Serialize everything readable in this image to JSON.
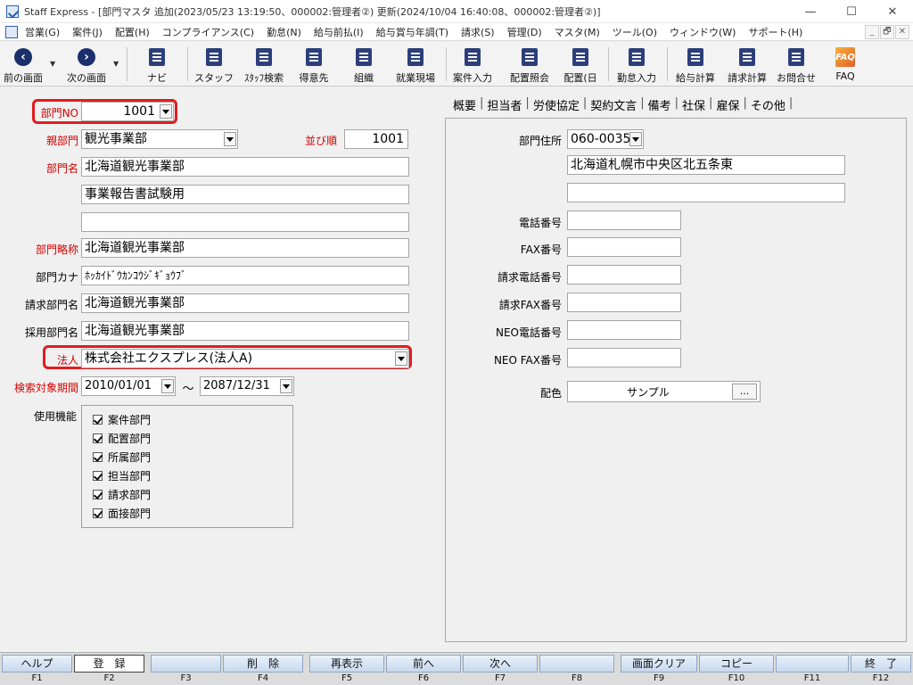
{
  "window": {
    "title": "Staff Express - [部門マスタ  追加(2023/05/23 13:19:50、000002:管理者②)  更新(2024/10/04 16:40:08、000002:管理者②)]",
    "minimize": "—",
    "maximize": "☐",
    "close": "✕"
  },
  "menu": [
    "営業(G)",
    "案件(J)",
    "配置(H)",
    "コンプライアンス(C)",
    "勤怠(N)",
    "給与前払(I)",
    "給与賞与年調(T)",
    "請求(S)",
    "管理(D)",
    "マスタ(M)",
    "ツール(O)",
    "ウィンドウ(W)",
    "サポート(H)"
  ],
  "mdi_controls": [
    "_",
    "🗗",
    "✕"
  ],
  "toolbar": {
    "back": "前の画面",
    "next": "次の画面",
    "navi": "ナビ",
    "staff": "スタッフ",
    "staff_search": "ｽﾀｯﾌ検索",
    "customer": "得意先",
    "org": "組織",
    "worksite": "就業現場",
    "case_entry": "案件入力",
    "placement_inquiry": "配置照会",
    "placement_day": "配置(日",
    "attendance_entry": "勤怠入力",
    "payroll": "給与計算",
    "billing": "請求計算",
    "contact": "お問合せ",
    "faq": "FAQ",
    "faq_icon_text": "FAQ"
  },
  "form": {
    "dept_no_label": "部門NO",
    "dept_no_value": "1001",
    "parent_label": "親部門",
    "parent_value": "観光事業部",
    "order_label": "並び順",
    "order_value": "1001",
    "name_label": "部門名",
    "name_line1": "北海道観光事業部",
    "name_line2": "事業報告書試験用",
    "name_line3": "",
    "abbr_label": "部門略称",
    "abbr_value": "北海道観光事業部",
    "kana_label": "部門カナ",
    "kana_value": "ﾎｯｶｲﾄﾞｳｶﾝｺｳｼﾞｷﾞｮｳﾌﾞ",
    "billing_name_label": "請求部門名",
    "billing_name_value": "北海道観光事業部",
    "hiring_name_label": "採用部門名",
    "hiring_name_value": "北海道観光事業部",
    "corp_label": "法人",
    "corp_value": "株式会社エクスプレス(法人A)",
    "period_label": "検索対象期間",
    "period_from": "2010/01/01",
    "period_tilde": "～",
    "period_to": "2087/12/31",
    "functions_label": "使用機能",
    "functions": [
      "案件部門",
      "配置部門",
      "所属部門",
      "担当部門",
      "請求部門",
      "面接部門"
    ]
  },
  "tabs": [
    "概要",
    "担当者",
    "労使協定",
    "契約文言",
    "備考",
    "社保",
    "雇保",
    "その他"
  ],
  "tab_separator": "|",
  "overview": {
    "address_label": "部門住所",
    "zip": "060-0035",
    "address1": "北海道札幌市中央区北五条東",
    "address2": "",
    "phone_label": "電話番号",
    "fax_label": "FAX番号",
    "billing_phone_label": "請求電話番号",
    "billing_fax_label": "請求FAX番号",
    "neo_phone_label": "NEO電話番号",
    "neo_fax_label": "NEO FAX番号",
    "color_label": "配色",
    "color_sample": "サンプル",
    "color_button": "..."
  },
  "fkeys": [
    {
      "key": "F1",
      "label": "ヘルプ"
    },
    {
      "key": "F2",
      "label": "登　録"
    },
    {
      "key": "F3",
      "label": ""
    },
    {
      "key": "F4",
      "label": "削　除"
    },
    {
      "key": "F5",
      "label": "再表示"
    },
    {
      "key": "F6",
      "label": "前へ"
    },
    {
      "key": "F7",
      "label": "次へ"
    },
    {
      "key": "F8",
      "label": ""
    },
    {
      "key": "F9",
      "label": "画面クリア"
    },
    {
      "key": "F10",
      "label": "コピー"
    },
    {
      "key": "F11",
      "label": ""
    },
    {
      "key": "F12",
      "label": "終　了"
    }
  ],
  "colors": {
    "required_label": "#d40000",
    "highlight": "#e11d1d",
    "toolbar_icon": "#1b2f6b"
  }
}
